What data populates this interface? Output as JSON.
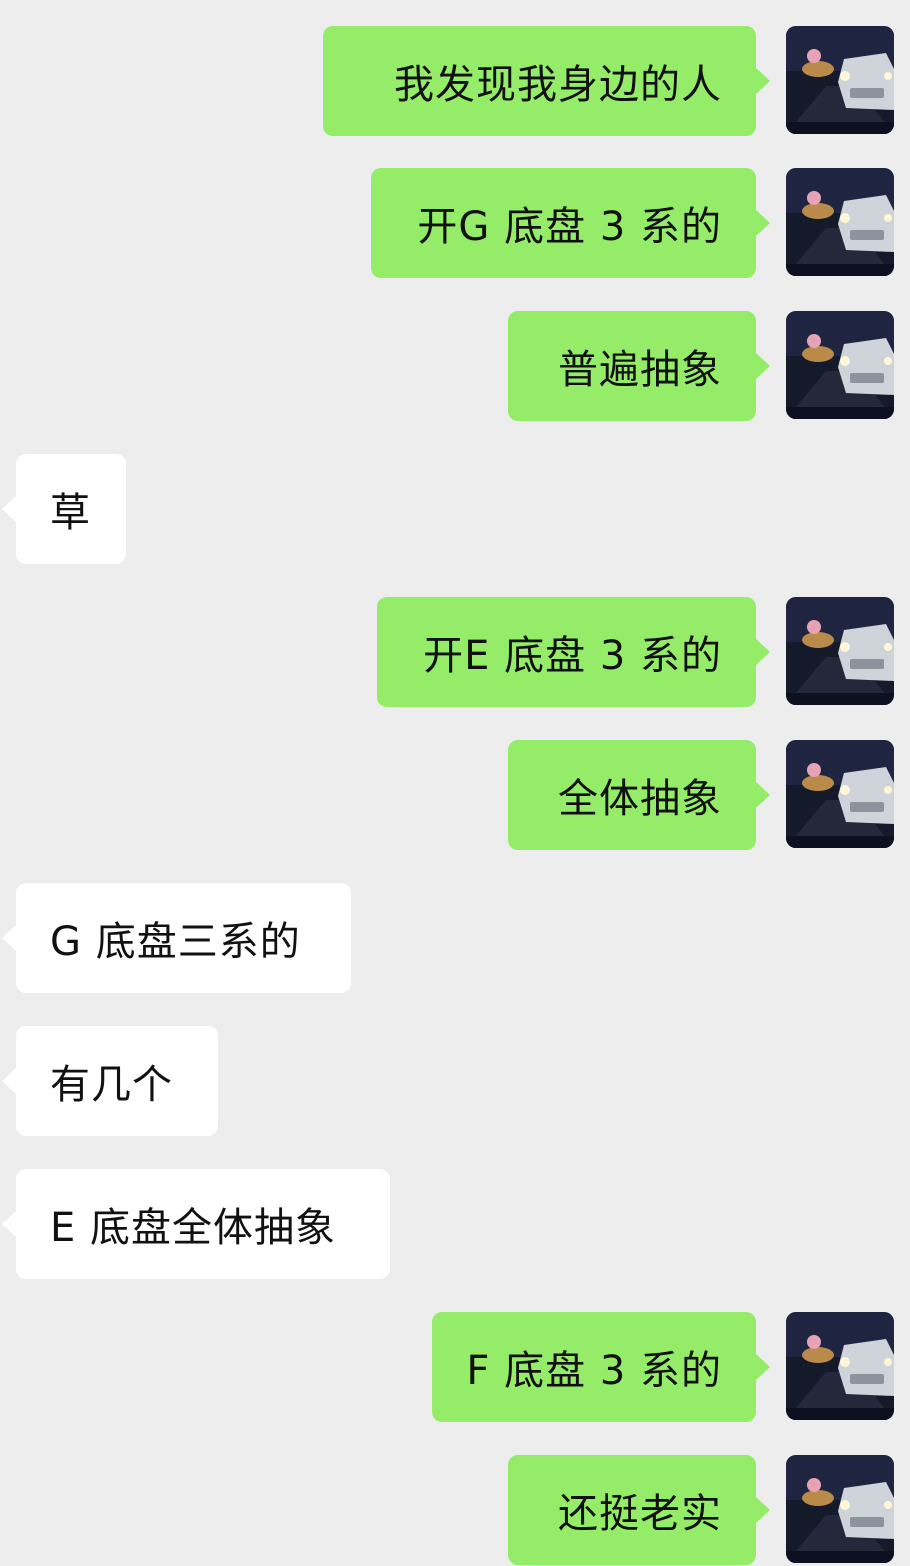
{
  "messages": [
    {
      "side": "out",
      "text": "我发现我身边的人"
    },
    {
      "side": "out",
      "text": "开G 底盘 3 系的"
    },
    {
      "side": "out",
      "text": "普遍抽象"
    },
    {
      "side": "in",
      "text": "草"
    },
    {
      "side": "out",
      "text": "开E 底盘 3 系的"
    },
    {
      "side": "out",
      "text": "全体抽象"
    },
    {
      "side": "in",
      "text": "G 底盘三系的"
    },
    {
      "side": "in",
      "text": "有几个"
    },
    {
      "side": "in",
      "text": "E 底盘全体抽象"
    },
    {
      "side": "out",
      "text": "F 底盘 3 系的"
    },
    {
      "side": "out",
      "text": "还挺老实"
    }
  ],
  "avatar": {
    "icon": "avatar-car-night-road-icon"
  },
  "colors": {
    "background": "#ededed",
    "outgoing_bubble": "#95ec69",
    "incoming_bubble": "#ffffff"
  }
}
